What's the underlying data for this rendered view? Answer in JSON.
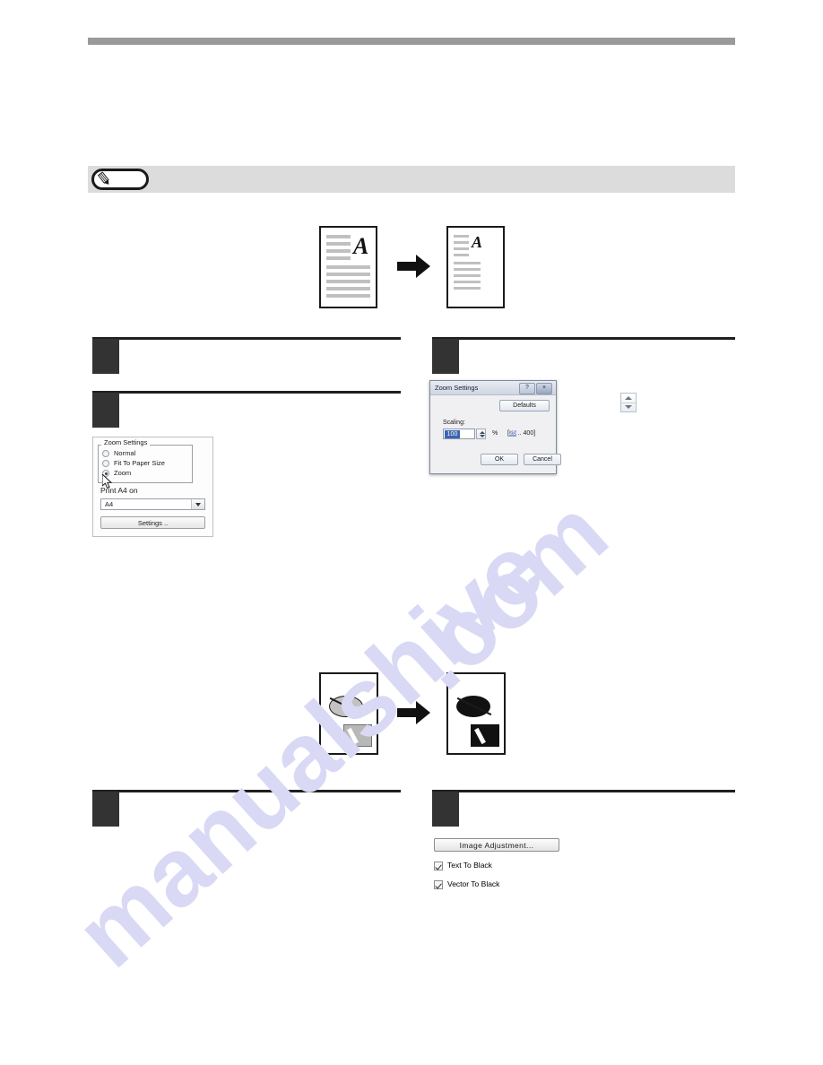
{
  "page": {
    "watermark_line1": "manualshive",
    "watermark_line2": ".com"
  },
  "note_banner": {
    "icon": "pencil-note-icon",
    "text": ""
  },
  "steps": [
    {
      "id": "step-left-1",
      "number": ""
    },
    {
      "id": "step-right-1",
      "number": ""
    },
    {
      "id": "step-left-2",
      "number": ""
    },
    {
      "id": "step-left-3",
      "number": ""
    },
    {
      "id": "step-right-2",
      "number": ""
    }
  ],
  "illustration_zoom": {
    "letter": "A",
    "arrow": "right-arrow-icon",
    "before_label": "",
    "after_label": ""
  },
  "illustration_vector": {
    "arrow": "right-arrow-icon",
    "before_label": "",
    "after_label": ""
  },
  "zoom_settings_panel": {
    "group_title": "Zoom Settings",
    "radios": [
      {
        "label": "Normal",
        "selected": false
      },
      {
        "label": "Fit To Paper Size",
        "selected": false
      },
      {
        "label": "Zoom",
        "selected": true
      }
    ],
    "print_on_label": "Print A4 on",
    "paper_combo_value": "A4",
    "settings_button": "Settings .."
  },
  "zoom_dialog": {
    "title": "Zoom Settings",
    "help_button": "?",
    "close_button": "×",
    "defaults_button": "Defaults",
    "scaling_label": "Scaling:",
    "scaling_value": "100",
    "percent_symbol": "%",
    "range_min": "25",
    "range_text": " .. 400]",
    "range_open": "[",
    "ok_button": "OK",
    "cancel_button": "Cancel"
  },
  "spinner_callout": {
    "name": "spin-up-down-control"
  },
  "image_adjustment": {
    "button_label": "Image Adjustment...",
    "checkboxes": [
      {
        "label": "Text To Black",
        "checked": true
      },
      {
        "label": "Vector To Black",
        "checked": true
      }
    ]
  },
  "colors": {
    "rule": "#9a9a9a",
    "note_bg": "#dcdcdc",
    "step_block": "#333333",
    "watermark": "#d9d9f5"
  }
}
